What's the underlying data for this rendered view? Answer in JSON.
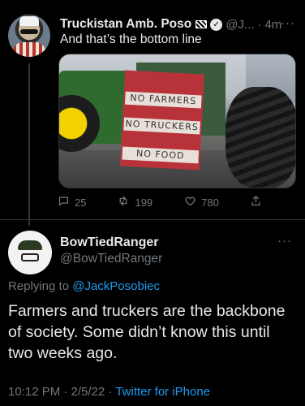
{
  "tweet1": {
    "name": "Truckistan Amb. Poso",
    "handle": "@J...",
    "dot": "·",
    "time": "4m",
    "text": "And that’s the bottom line",
    "photo_sign_lines": [
      "NO FARMERS",
      "NO TRUCKERS",
      "NO FOOD"
    ],
    "reply_count": "25",
    "retweet_count": "199",
    "like_count": "780"
  },
  "tweet2": {
    "name": "BowTiedRanger",
    "handle": "@BowTiedRanger",
    "replying_prefix": "Replying to ",
    "replying_to": "@JackPosobiec",
    "text": "Farmers and truckers are the backbone of society. Some didn’t know this until two weeks ago.",
    "timestamp": "10:12 PM · 2/5/22 · ",
    "client": "Twitter for iPhone"
  },
  "colors": {
    "background": "#000000",
    "primary_text": "#e7e9ea",
    "secondary_text": "#71767b",
    "link": "#1d9bf0"
  },
  "icons": [
    "flag-icon",
    "verified-icon",
    "more-icon",
    "reply-icon",
    "retweet-icon",
    "like-icon",
    "share-icon"
  ]
}
